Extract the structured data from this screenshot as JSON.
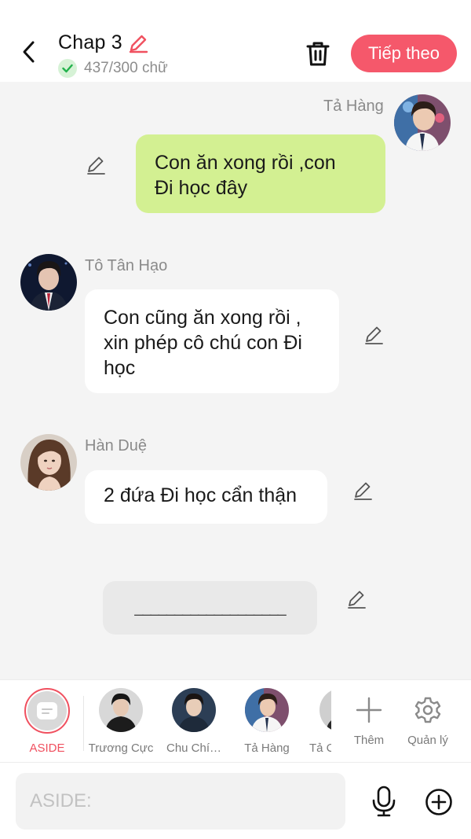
{
  "header": {
    "title": "Chap 3",
    "word_count": "437/300 chữ",
    "next_label": "Tiếp theo"
  },
  "messages": [
    {
      "sender": "Tả Hàng",
      "text_line1": "Con ăn xong rồi ,con",
      "text_line2": "Đi học đây",
      "side": "right"
    },
    {
      "sender": "Tô Tân Hạo",
      "text_line1": "Con cũng ăn xong rồi ,",
      "text_line2": "xin phép cô chú con Đi",
      "text_line3": "học",
      "side": "left"
    },
    {
      "sender": "Hàn Duệ",
      "text_line1": "2 đứa Đi học cẩn thận",
      "side": "left"
    },
    {
      "sender": "",
      "text_line1": "___________________",
      "side": "aside"
    }
  ],
  "characters": [
    {
      "label": "ASIDE",
      "selected": true
    },
    {
      "label": "Trương Cực"
    },
    {
      "label": "Chu Chí…"
    },
    {
      "label": "Tả Hàng"
    },
    {
      "label": "Tả C"
    }
  ],
  "tools": {
    "add_label": "Thêm",
    "manage_label": "Quản lý"
  },
  "input": {
    "placeholder": "ASIDE:"
  },
  "colors": {
    "accent": "#f5586b",
    "bubble_green": "#d3f092",
    "chat_bg": "#f4f4f4"
  }
}
